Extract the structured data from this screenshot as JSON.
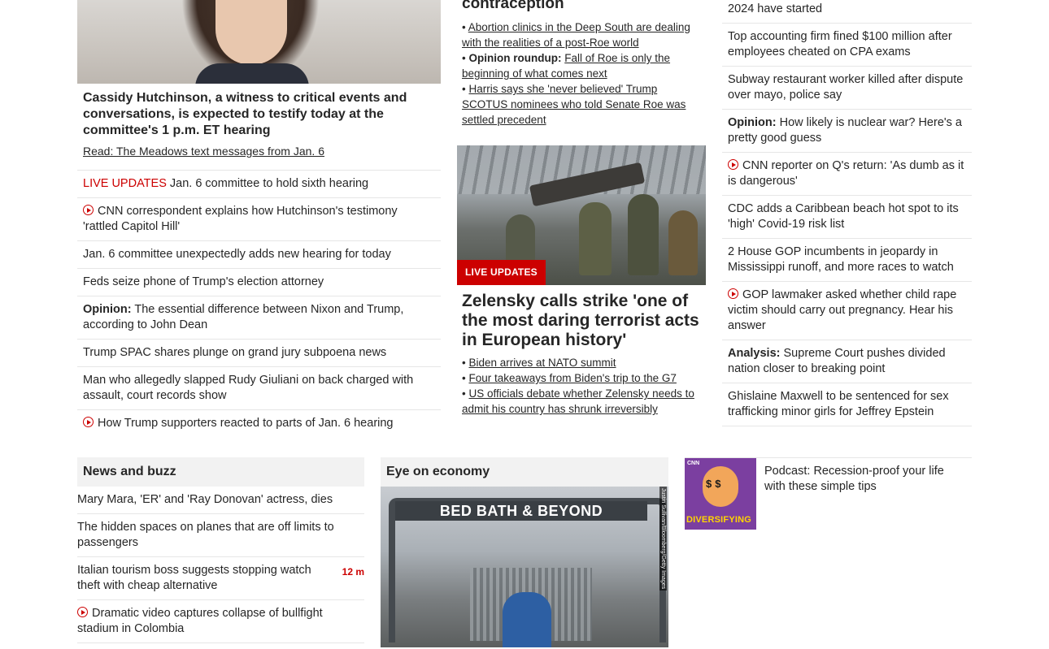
{
  "left": {
    "headline": "Cassidy Hutchinson, a witness to critical events and conversations, is expected to testify today at the committee's 1 p.m. ET hearing",
    "sub_link": "Read: The Meadows text messages from Jan. 6",
    "items": [
      {
        "prefix": "LIVE UPDATES",
        "text": "Jan. 6 committee to hold sixth hearing"
      },
      {
        "video": true,
        "text": "CNN correspondent explains how Hutchinson's testimony 'rattled Capitol Hill'"
      },
      {
        "text": "Jan. 6 committee unexpectedly adds new hearing for today"
      },
      {
        "text": "Feds seize phone of Trump's election attorney"
      },
      {
        "prefix": "Opinion:",
        "text": "The essential difference between Nixon and Trump, according to John Dean"
      },
      {
        "text": "Trump SPAC shares plunge on grand jury subpoena news"
      },
      {
        "text": "Man who allegedly slapped Rudy Giuliani on back charged with assault, court records show"
      },
      {
        "video": true,
        "text": "How Trump supporters reacted to parts of Jan. 6 hearing"
      }
    ]
  },
  "mid": {
    "top_title": "contraception",
    "top_bullets": [
      {
        "text": "Abortion clinics in the Deep South are dealing with the realities of a post-Roe world"
      },
      {
        "prefix": "Opinion roundup:",
        "text": "Fall of Roe is only the beginning of what comes next"
      },
      {
        "text": "Harris says she 'never believed' Trump SCOTUS nominees who told Senate Roe was settled precedent"
      }
    ],
    "badge": "LIVE UPDATES",
    "headline": "Zelensky calls strike 'one of the most daring terrorist acts in European history'",
    "bullets": [
      {
        "text": "Biden arrives at NATO summit"
      },
      {
        "text": "Four takeaways from Biden's trip to the G7"
      },
      {
        "text": "US officials debate whether Zelensky needs to admit his country has shrunk irreversibly"
      }
    ]
  },
  "right": {
    "items": [
      {
        "text": "2024 have started"
      },
      {
        "text": "Top accounting firm fined $100 million after employees cheated on CPA exams"
      },
      {
        "text": "Subway restaurant worker killed after dispute over mayo, police say"
      },
      {
        "prefix": "Opinion:",
        "text": "How likely is nuclear war? Here's a pretty good guess"
      },
      {
        "video": true,
        "text": "CNN reporter on Q's return: 'As dumb as it is dangerous'"
      },
      {
        "text": "CDC adds a Caribbean beach hot spot to its 'high' Covid-19 risk list"
      },
      {
        "text": "2 House GOP incumbents in jeopardy in Mississippi runoff, and more races to watch"
      },
      {
        "video": true,
        "text": "GOP lawmaker asked whether child rape victim should carry out pregnancy. Hear his answer"
      },
      {
        "prefix": "Analysis:",
        "text": "Supreme Court pushes divided nation closer to breaking point"
      },
      {
        "text": "Ghislaine Maxwell to be sentenced for sex trafficking minor girls for Jeffrey Epstein"
      }
    ]
  },
  "news_buzz": {
    "title": "News and buzz",
    "items": [
      {
        "text": "Mary Mara, 'ER' and 'Ray Donovan' actress, dies"
      },
      {
        "text": "The hidden spaces on planes that are off limits to passengers"
      },
      {
        "text": "Italian tourism boss suggests stopping watch theft with cheap alternative",
        "time": "12 m"
      },
      {
        "video": true,
        "text": "Dramatic video captures collapse of bullfight stadium in Colombia"
      }
    ]
  },
  "economy": {
    "title": "Eye on economy",
    "sign": "BED BATH & BEYOND",
    "credit": "Justin Sullivan/Bloomberg/Getty Images"
  },
  "podcast": {
    "logo": "CNN",
    "show": "DIVERSIFYING",
    "text": "Podcast: Recession-proof your life with these simple tips"
  },
  "colors": {
    "accent_red": "#cc0000",
    "divider": "#e6e6e6",
    "section_bg": "#f2f2f2"
  }
}
